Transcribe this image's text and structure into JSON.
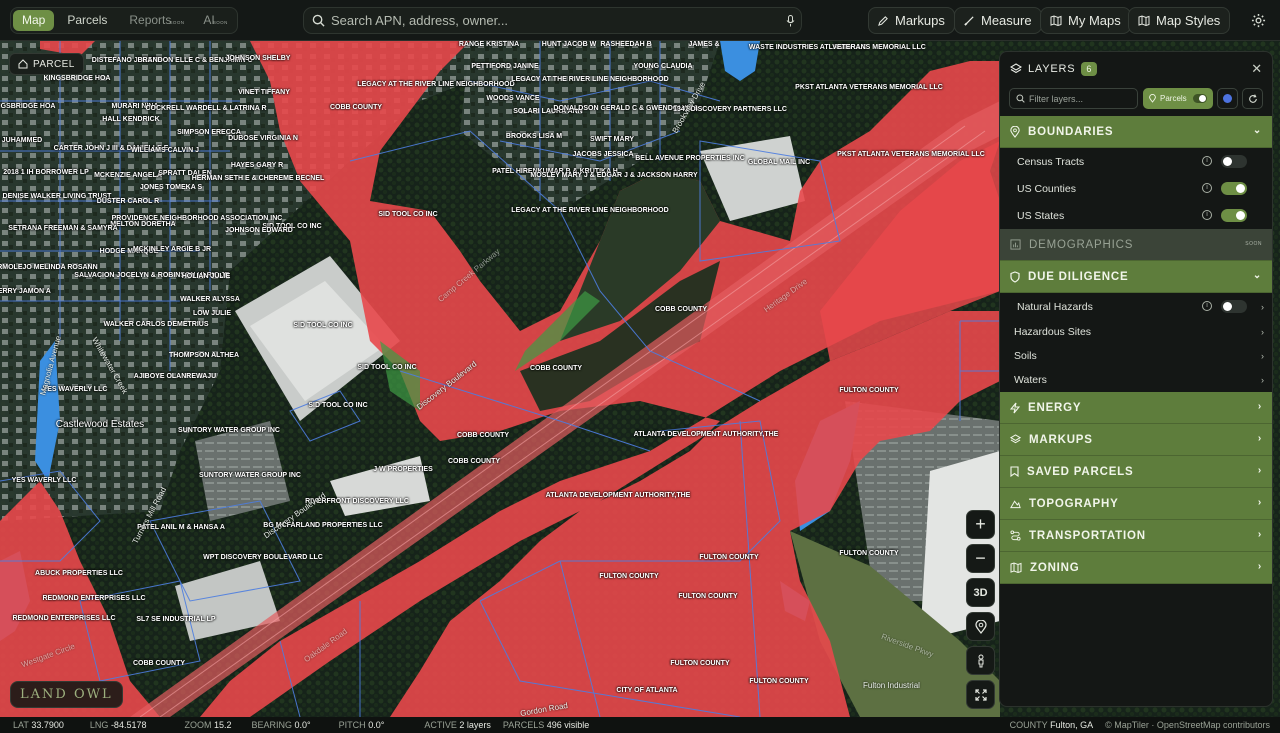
{
  "topbar": {
    "tabs": [
      {
        "label": "Map",
        "active": true
      },
      {
        "label": "Parcels"
      },
      {
        "label": "Reports",
        "badge": "SOON"
      },
      {
        "label": "AI",
        "badge": "SOON"
      }
    ],
    "search_placeholder": "Search APN, address, owner...",
    "buttons": [
      "Markups",
      "Measure",
      "My Maps",
      "Map Styles"
    ]
  },
  "map": {
    "parcel_button": "PARCEL",
    "logo": "LAND OWL",
    "controls": [
      "+",
      "−",
      "3D"
    ],
    "labels": [
      "RANGE KRISTINA",
      "HUNT JACOB W",
      "RASHEEDAH B",
      "JAMES &",
      "WASTE INDUSTRIES ATLANTA LLC",
      "VETERANS MEMORIAL LLC",
      "DISTEFANO JOSEPH",
      "BRANDON ELLE C & BENJAMIN C",
      "JOHNSON SHELBY",
      "PETTIFORD JANINE",
      "YOUNG CLAUDIA",
      "KINGSBRIDGE HOA",
      "LEGACY AT THE RIVER LINE NEIGHBORHOOD",
      "LEGACY AT THE RIVER LINE NEIGHBORHOOD",
      "VINET TIFFANY",
      "COBB COUNTY",
      "WOODS VANCE",
      "PKST ATLANTA VETERANS MEMORIAL LLC",
      "KINGSBRIDGE HOA",
      "MURARI NINA",
      "COCKRELL WARDELL & LATRINA R",
      "SOLARI LAURA ANN",
      "DONALDSON GERALD C & GWENDOLYN &",
      "1341 DISCOVERY PARTNERS LLC",
      "HALL KENDRICK",
      "SIMPSON ERECCA",
      "BROOKS LISA M",
      "SWIFT MARY",
      "JAH JUHAMMED",
      "CARTER JOHN J III & DANIELLE E",
      "WILLIAMS CALVIN J",
      "DUBOSE VIRGINIA N",
      "JACOBS JESSICA",
      "BELL AVENUE PROPERTIES INC",
      "PKST ATLANTA VETERANS MEMORIAL LLC",
      "GLOBAL MAIL INC",
      "2018 1 IH BORROWER LP",
      "MCKENZIE ANGELA",
      "SPRATT DALEN",
      "HAYES GARY R",
      "PATEL HIRENKUMAR B & KRUTIKA H",
      "MOSLEY MARY J & EDGAR J & JACKSON HARRY",
      "JONES TOMEKA S",
      "HERMAN SETH E & CHEREME BECNEL",
      "DENISE WALKER LIVING TRUST",
      "DUSTER CAROL R",
      "LEGACY AT THE RIVER LINE NEIGHBORHOOD",
      "MELTON DORETHA",
      "PROVIDENCE NEIGHBORHOOD ASSOCIATION INC",
      "SID TOOL CO INC",
      "SID TOOL CO INC",
      "JOHNSON EDWARD",
      "SETRANA FREEMAN & SAMYRA",
      "HODGE MARQUE",
      "MCKINLEY ARGIE B JR",
      "MARMOLEJO MELINDA ROSANN",
      "SALVACION JOCELYN & ROBINSON ULRIC JR",
      "HOLIAN JULIE",
      "PERRY JAMON A",
      "WALKER ALYSSA",
      "LOW JULIE",
      "WALKER CARLOS DEMETRIUS",
      "SID TOOL CO INC",
      "COBB COUNTY",
      "THOMPSON ALTHEA",
      "SID TOOL CO INC",
      "COBB COUNTY",
      "YES WAVERLY LLC",
      "AJIBOYE OLANREWAJU",
      "SID TOOL CO INC",
      "FULTON COUNTY",
      "SUNTORY WATER GROUP INC",
      "COBB COUNTY",
      "ATLANTA DEVELOPMENT AUTHORITY,THE",
      "COBB COUNTY",
      "SUNTORY WATER GROUP INC",
      "J W PROPERTIES",
      "YES WAVERLY LLC",
      "RIVERFRONT DISCOVERY LLC",
      "ATLANTA DEVELOPMENT AUTHORITY,THE",
      "PATEL ANIL M & HANSA A",
      "BG MCFARLAND PROPERTIES LLC",
      "FULTON COUNTY",
      "FULTON COUNTY",
      "WPT DISCOVERY BOULEVARD LLC",
      "ABUCK PROPERTIES LLC",
      "FULTON COUNTY",
      "FULTON COUNTY",
      "REDMOND ENTERPRISES LLC",
      "REDMOND ENTERPRISES LLC",
      "SL7 SE INDUSTRIAL LP",
      "COBB COUNTY",
      "FULTON COUNTY",
      "CITY OF ATLANTA",
      "FULTON COUNTY"
    ],
    "place_label": "Castlewood Estates",
    "roads": [
      "Discovery Boulevard",
      "Discovery Boulevard",
      "Turners Mill Road",
      "Whitewater Creek",
      "Magnolia Avenue",
      "Brookview Drive",
      "Fulton Industrial",
      "Gordon Road",
      "Camp Creek Parkway",
      "Oakdale Road",
      "Heritage Drive",
      "Riverside Pkwy",
      "Westgate Circle"
    ]
  },
  "layers": {
    "title": "LAYERS",
    "count": "6",
    "filter_placeholder": "Filter layers...",
    "parcels_chip": "Parcels",
    "sections": [
      {
        "title": "BOUNDARIES",
        "expanded": true,
        "rows": [
          {
            "label": "Census Tracts",
            "on": false
          },
          {
            "label": "US Counties",
            "on": true
          },
          {
            "label": "US States",
            "on": true
          }
        ]
      },
      {
        "title": "DEMOGRAPHICS",
        "soon": "SOON"
      },
      {
        "title": "DUE DILIGENCE",
        "expanded": true,
        "rows": [
          {
            "label": "Natural Hazards",
            "on": false
          }
        ],
        "subrows": [
          "Hazardous Sites",
          "Soils",
          "Waters"
        ]
      },
      {
        "title": "ENERGY"
      },
      {
        "title": "MARKUPS"
      },
      {
        "title": "SAVED PARCELS"
      },
      {
        "title": "TOPOGRAPHY"
      },
      {
        "title": "TRANSPORTATION"
      },
      {
        "title": "ZONING"
      }
    ]
  },
  "status": {
    "lat_label": "LAT",
    "lat": "33.7900",
    "lng_label": "LNG",
    "lng": "-84.5178",
    "zoom_label": "ZOOM",
    "zoom": "15.2",
    "bearing_label": "BEARING",
    "bearing": "0.0°",
    "pitch_label": "PITCH",
    "pitch": "0.0°",
    "active_label": "ACTIVE",
    "active": "2 layers",
    "parcels_label": "PARCELS",
    "parcels": "496 visible",
    "county_label": "COUNTY",
    "county": "Fulton, GA",
    "attribution": "© MapTiler · OpenStreetMap contributors"
  },
  "colors": {
    "accent": "#6e8f45",
    "flood": "#e8484b",
    "parcel_line": "#3d6fd0"
  }
}
